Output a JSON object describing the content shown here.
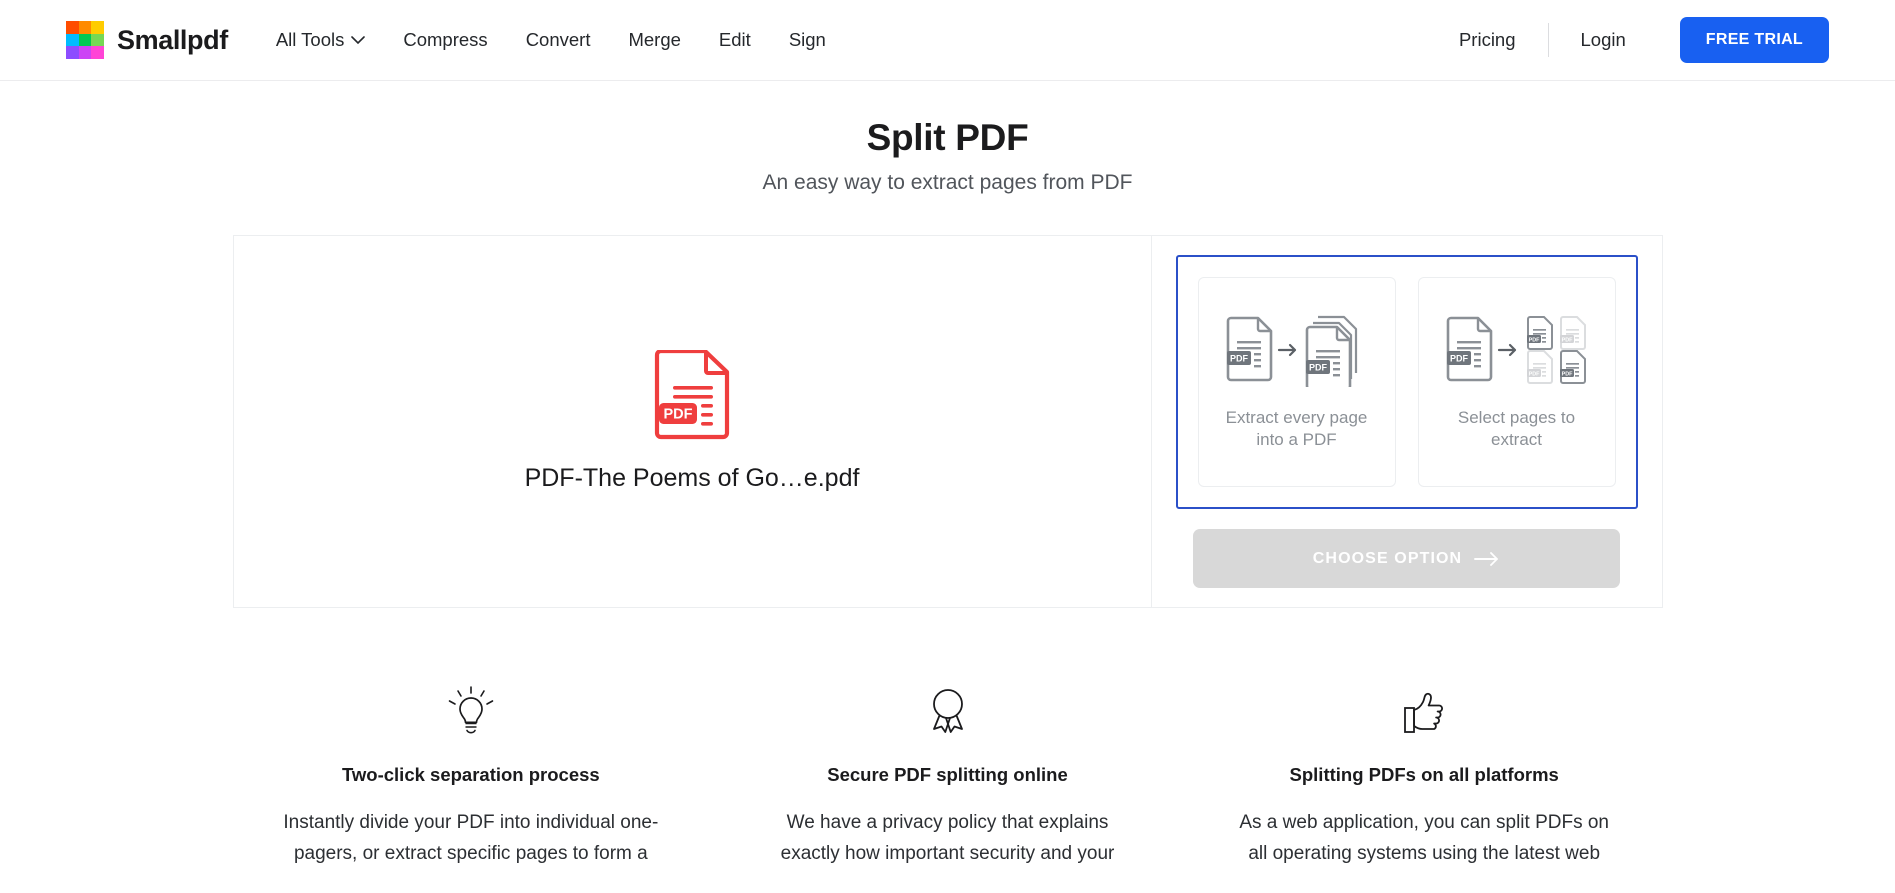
{
  "header": {
    "brand_name": "Smallpdf",
    "logo_colors": [
      "#ff4d00",
      "#ff8a00",
      "#ffcc00",
      "#00bbff",
      "#00c853",
      "#76d854",
      "#8c4dff",
      "#cc44f5",
      "#ff44d6"
    ],
    "nav_items": [
      {
        "label": "All Tools",
        "has_chevron": true
      },
      {
        "label": "Compress",
        "has_chevron": false
      },
      {
        "label": "Convert",
        "has_chevron": false
      },
      {
        "label": "Merge",
        "has_chevron": false
      },
      {
        "label": "Edit",
        "has_chevron": false
      },
      {
        "label": "Sign",
        "has_chevron": false
      }
    ],
    "pricing_label": "Pricing",
    "login_label": "Login",
    "free_trial_label": "FREE TRIAL",
    "accent_color": "#1860f1"
  },
  "hero": {
    "title": "Split PDF",
    "subtitle": "An easy way to extract pages from PDF"
  },
  "tool": {
    "file": {
      "name": "PDF-The Poems of Go…e.pdf",
      "badge": "PDF",
      "icon_color": "#ef3e3e"
    },
    "selection_border_color": "#2b50c8",
    "options": [
      {
        "label": "Extract every page into a PDF",
        "icon": "extract-every-page-icon",
        "selected": false
      },
      {
        "label": "Select pages to extract",
        "icon": "select-pages-icon",
        "selected": false
      }
    ],
    "choose_option_label": "CHOOSE OPTION",
    "choose_option_enabled": false
  },
  "features": [
    {
      "icon": "lightbulb-icon",
      "title": "Two-click separation process",
      "description": "Instantly divide your PDF into individual one-pagers, or extract specific pages to form a"
    },
    {
      "icon": "award-ribbon-icon",
      "title": "Secure PDF splitting online",
      "description": "We have a privacy policy that explains exactly how important security and your"
    },
    {
      "icon": "thumbs-up-icon",
      "title": "Splitting PDFs on all platforms",
      "description": "As a web application, you can split PDFs on all operating systems using the latest web"
    }
  ]
}
